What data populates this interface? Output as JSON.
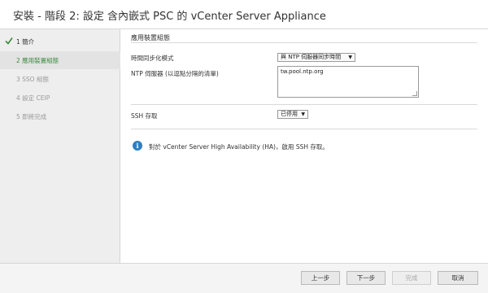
{
  "window": {
    "title": "安裝 - 階段 2: 設定 含內嵌式 PSC 的 vCenter Server Appliance"
  },
  "sidebar": {
    "steps": [
      {
        "label": "1 簡介",
        "state": "done"
      },
      {
        "label": "2 應用裝置組態",
        "state": "active"
      },
      {
        "label": "3 SSO 組態",
        "state": "pending"
      },
      {
        "label": "4 設定 CEIP",
        "state": "pending"
      },
      {
        "label": "5 即將完成",
        "state": "pending"
      }
    ]
  },
  "main": {
    "section_title": "應用裝置組態",
    "time_sync": {
      "label": "時間同步化模式",
      "value": "與 NTP 伺服器同步時間"
    },
    "ntp": {
      "label": "NTP 伺服器 (以逗點分隔的清單)",
      "value": "tw.pool.ntp.org"
    },
    "ssh": {
      "label": "SSH 存取",
      "value": "已停用"
    },
    "info": {
      "icon": "info-icon",
      "text": "對於 vCenter Server High Availability (HA)，啟用 SSH 存取。"
    }
  },
  "footer": {
    "back": "上一步",
    "next": "下一步",
    "finish": "完成",
    "cancel": "取消"
  },
  "colors": {
    "accent_green": "#3b8a3e",
    "info_blue": "#2f7fc1"
  }
}
